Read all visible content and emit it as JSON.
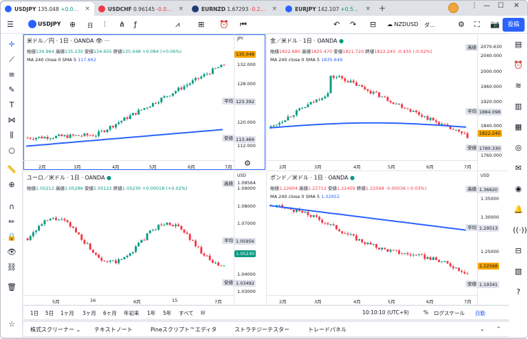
{
  "tabs": [
    {
      "title": "USDJPY",
      "price": "135.048",
      "change": "+0.0...",
      "color": "#2962ff",
      "active": true
    },
    {
      "title": "USDCHF",
      "price": "0.96145",
      "change": "-0.0...",
      "color": "#f23645",
      "active": false
    },
    {
      "title": "EURNZD",
      "price": "1.67293",
      "change": "-0.2...",
      "color": "#1e3c72",
      "active": false
    },
    {
      "title": "EURJPY",
      "price": "142.107",
      "change": "+0.5...",
      "color": "#2962ff",
      "active": false
    }
  ],
  "toolbar": {
    "symbol": "USDJPY",
    "interval": "日",
    "compare_symbol": "NZDUSD",
    "compare_label": "ダ...",
    "publish": "投稿"
  },
  "panes": [
    {
      "id": "p1",
      "title": "米ドル／円 · 1日 · OANDA",
      "currency": "JPY",
      "ohlc": {
        "o_label": "始値",
        "o": "134.964",
        "h_label": "高値",
        "h": "135.230",
        "l_label": "安値",
        "l": "134.655",
        "c_label": "終値",
        "c": "135.048",
        "chg": "+0.084 (+0.06%)"
      },
      "ma": "MA 240 close 0 SMA 5",
      "ma_val": "117.662",
      "price_labels": [
        "136.0",
        "132.000",
        "128.000",
        "124.000",
        "120.000",
        "116.000",
        "112.000"
      ],
      "tags": {
        "current": "135.048",
        "avg_label": "平均",
        "avg": "123.392",
        "low_label": "安値",
        "low": "113.469",
        "high": "135.230"
      },
      "times": [
        "2月",
        "3月",
        "4月",
        "5月",
        "6月",
        "7月"
      ]
    },
    {
      "id": "p2",
      "title": "金／米ドル · 1日 · OANDA",
      "currency": "USD",
      "ohlc": {
        "o_label": "始値",
        "o": "1822.680",
        "h_label": "高値",
        "h": "1825.470",
        "l_label": "安値",
        "l": "1821.720",
        "c_label": "終値",
        "c": "1822.245",
        "chg": "-0.435 (-0.02%)"
      },
      "ma": "MA 240 close 0 SMA 5",
      "ma_val": "1835.649",
      "price_labels": [
        "2070.630",
        "2040.000",
        "2000.000",
        "1960.000",
        "1920.000",
        "1880.000",
        "1840.000",
        "1800.000",
        "1760.000"
      ],
      "tags": {
        "high_label": "高値",
        "current": "1822.245",
        "avg_label": "平均",
        "avg": "1884.098",
        "low_label": "安値",
        "low": "1780.330"
      },
      "times": [
        "2月",
        "3月",
        "4月",
        "5月",
        "6月",
        "7月"
      ]
    },
    {
      "id": "p3",
      "title": "ユーロ／米ドル · 1日 · OANDA",
      "currency": "USD",
      "ohlc": {
        "o_label": "始値",
        "o": "1.05212",
        "h_label": "高値",
        "h": "1.05286",
        "l_label": "安値",
        "l": "1.05122",
        "c_label": "終値",
        "c": "1.05230",
        "chg": "+0.00018 (+0.02%)"
      },
      "ma": "",
      "ma_val": "",
      "price_labels": [
        "1.09564",
        "1.09000",
        "1.08000",
        "1.07000",
        "1.06000",
        "1.05000",
        "1.04000",
        "1.03000"
      ],
      "tags": {
        "high_label": "高値",
        "current": "1.05230",
        "avg_label": "平均",
        "avg": "1.05956",
        "low_label": "安値",
        "low": "1.03492"
      },
      "times": [
        "5月",
        "16",
        "6月",
        "15",
        "7月"
      ]
    },
    {
      "id": "p4",
      "title": "ポンド／米ドル · 1日 · OANDA",
      "currency": "USD",
      "ohlc": {
        "o_label": "始値",
        "o": "1.22604",
        "h_label": "高値",
        "h": "1.22712",
        "l_label": "安値",
        "l": "1.22409",
        "c_label": "終値",
        "c": "1.22568",
        "chg": "-0.00036 (-0.03%)"
      },
      "ma": "MA 240 close 0 SMA 5",
      "ma_val": "1.32952",
      "price_labels": [
        "1.35000",
        "1.30000",
        "1.25000",
        "1.20000"
      ],
      "tags": {
        "high_label": "高値",
        "high": "1.36620",
        "current": "1.22568",
        "avg_label": "平均",
        "avg": "1.29513",
        "low_label": "安値",
        "low": "1.19341"
      },
      "times": [
        "2月",
        "3月",
        "4月",
        "5月",
        "6月",
        "7月"
      ]
    }
  ],
  "bottombar": {
    "ranges": [
      "1日",
      "5日",
      "1ヶ月",
      "3ヶ月",
      "6ヶ月",
      "年初来",
      "1年",
      "5年",
      "すべて"
    ],
    "time": "10:10:10 (UTC+9)",
    "percent": "%",
    "log": "ログスケール",
    "auto": "自動"
  },
  "panelbar": {
    "items": [
      "株式スクリーナー",
      "テキストノート",
      "Pineスクリプト™エディタ",
      "ストラテジーテスター",
      "トレードパネル"
    ]
  },
  "colors": {
    "up": "#089981",
    "down": "#f23645",
    "ma": "#2962ff",
    "accent": "#2962ff"
  }
}
